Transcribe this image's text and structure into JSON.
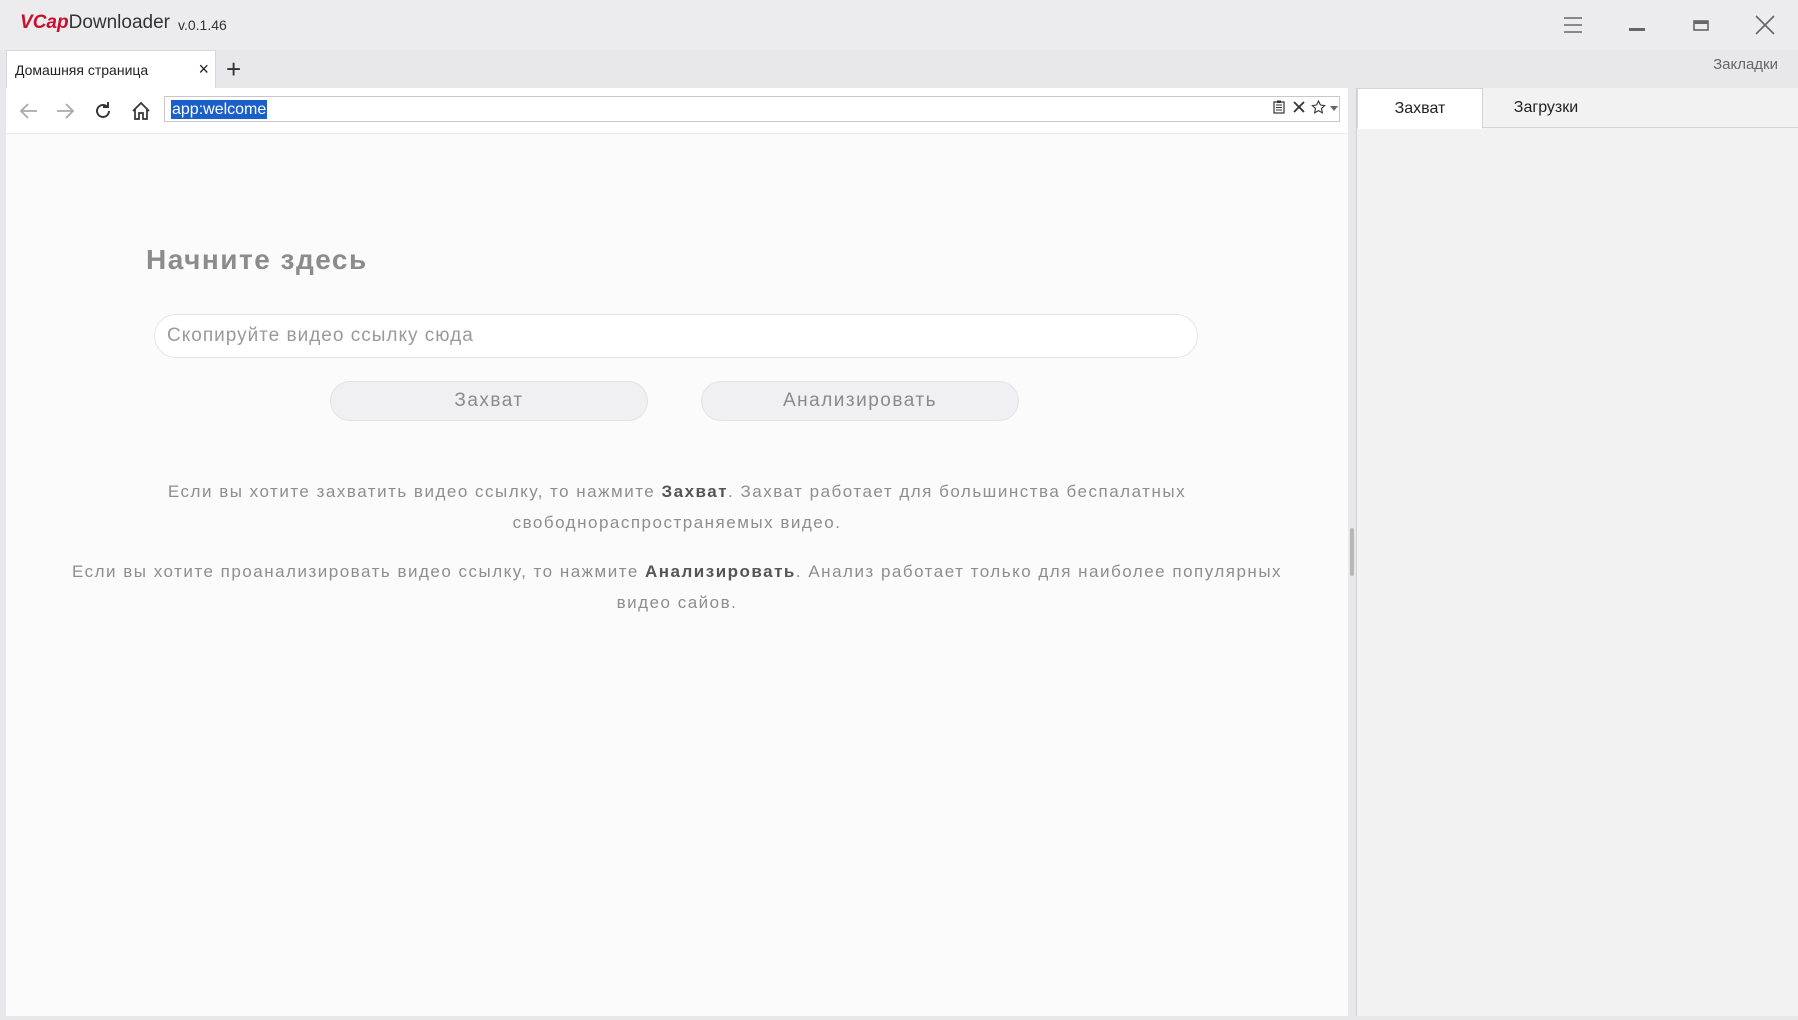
{
  "app": {
    "logo_v": "V",
    "logo_cap": "Cap",
    "logo_name": "Downloader",
    "version": "v.0.1.46"
  },
  "window_controls": {
    "menu": "menu-icon",
    "minimize": "minimize-icon",
    "maximize": "maximize-icon",
    "close": "close-icon"
  },
  "tabs": [
    {
      "label": "Домашняя страница",
      "close": "×"
    }
  ],
  "new_tab": "+",
  "bookmarks_label": "Закладки",
  "navbar": {
    "url": "app:welcome"
  },
  "welcome": {
    "heading": "Начните здесь",
    "input_placeholder": "Скопируйте видео ссылку сюда",
    "capture_button": "Захват",
    "analyze_button": "Анализировать",
    "info1_prefix": "Если вы хотите захватить видео ссылку, то нажмите ",
    "info1_bold": "Захват",
    "info1_suffix": ". Захват работает для большинства беспалатных свободнораспространяемых видео.",
    "info2_prefix": "Если вы хотите проанализировать видео ссылку, то нажмите ",
    "info2_bold": "Анализировать",
    "info2_suffix": ". Анализ работает только для наиболее популярных видео сайов."
  },
  "side_panel": {
    "tabs": [
      {
        "label": "Захват",
        "active": true
      },
      {
        "label": "Загрузки",
        "active": false
      }
    ]
  },
  "colors": {
    "url_selection": "#1b5fc8",
    "logo_red": "#c8102e"
  }
}
